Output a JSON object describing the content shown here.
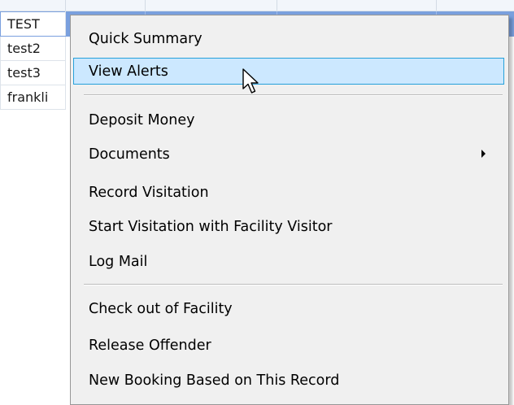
{
  "grid": {
    "rows": [
      {
        "name": "TEST",
        "selected": true
      },
      {
        "name": "test2",
        "selected": false
      },
      {
        "name": "test3",
        "selected": false
      },
      {
        "name": "frankli",
        "selected": false
      }
    ]
  },
  "context_menu": {
    "hovered_item": "View Alerts",
    "groups": [
      [
        "Quick Summary",
        "View Alerts"
      ],
      [
        "Deposit Money",
        "Documents",
        "Record Visitation",
        "Start Visitation with Facility Visitor",
        "Log Mail"
      ],
      [
        "Check out of Facility",
        "Release Offender",
        "New Booking Based on This Record"
      ]
    ],
    "items": {
      "quick_summary": "Quick Summary",
      "view_alerts": "View Alerts",
      "deposit_money": "Deposit Money",
      "documents": "Documents",
      "record_visitation": "Record Visitation",
      "start_visitation": "Start Visitation with Facility Visitor",
      "log_mail": "Log Mail",
      "check_out": "Check out of Facility",
      "release_offender": "Release Offender",
      "new_booking": "New Booking Based on This Record"
    },
    "submenu_items": [
      "Documents"
    ]
  },
  "icons": {
    "cursor": "mouse-pointer-icon",
    "submenu_arrow": "chevron-right-icon"
  },
  "colors": {
    "selected_row": "#7aa0de",
    "menu_background": "#f0f0f0",
    "hover_fill": "#cce8ff",
    "hover_border": "#26a0da"
  }
}
